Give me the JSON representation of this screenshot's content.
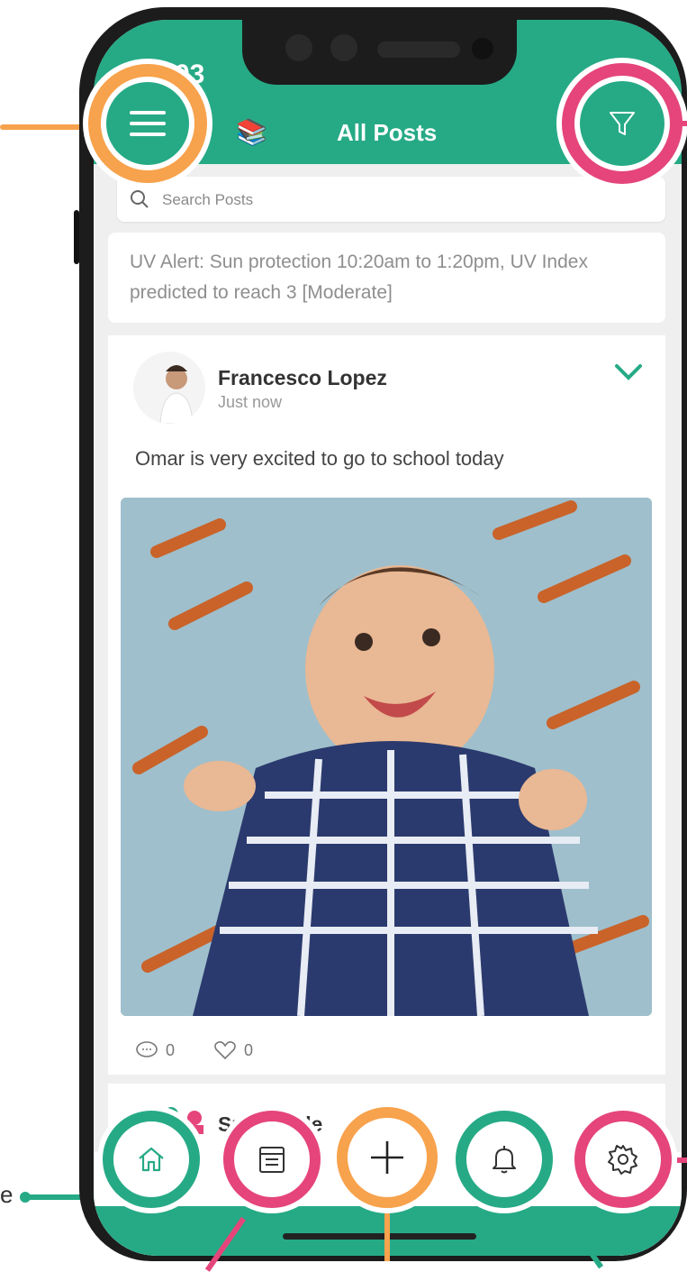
{
  "status_bar": {
    "time": ":03"
  },
  "header": {
    "title": "All Posts"
  },
  "search": {
    "placeholder": "Search Posts"
  },
  "alert": {
    "text": "UV Alert: Sun protection 10:20am to 1:20pm, UV Index predicted to reach 3 [Moderate]"
  },
  "post": {
    "author": "Francesco Lopez",
    "time": "Just now",
    "text": "Omar is very excited to go to school today",
    "comments": "0",
    "likes": "0"
  },
  "next_post": {
    "author": "Sunnyside",
    "sub": "/"
  },
  "tabs": [
    {
      "name": "home",
      "icon": "home-icon"
    },
    {
      "name": "journal",
      "icon": "calendar-icon"
    },
    {
      "name": "add",
      "icon": "plus-icon"
    },
    {
      "name": "notifications",
      "icon": "bell-icon"
    },
    {
      "name": "settings",
      "icon": "gear-icon"
    }
  ],
  "annotation_side_text": "e",
  "colors": {
    "brand_green": "#26aa86",
    "orange": "#f7a24c",
    "pink": "#e5457a"
  }
}
